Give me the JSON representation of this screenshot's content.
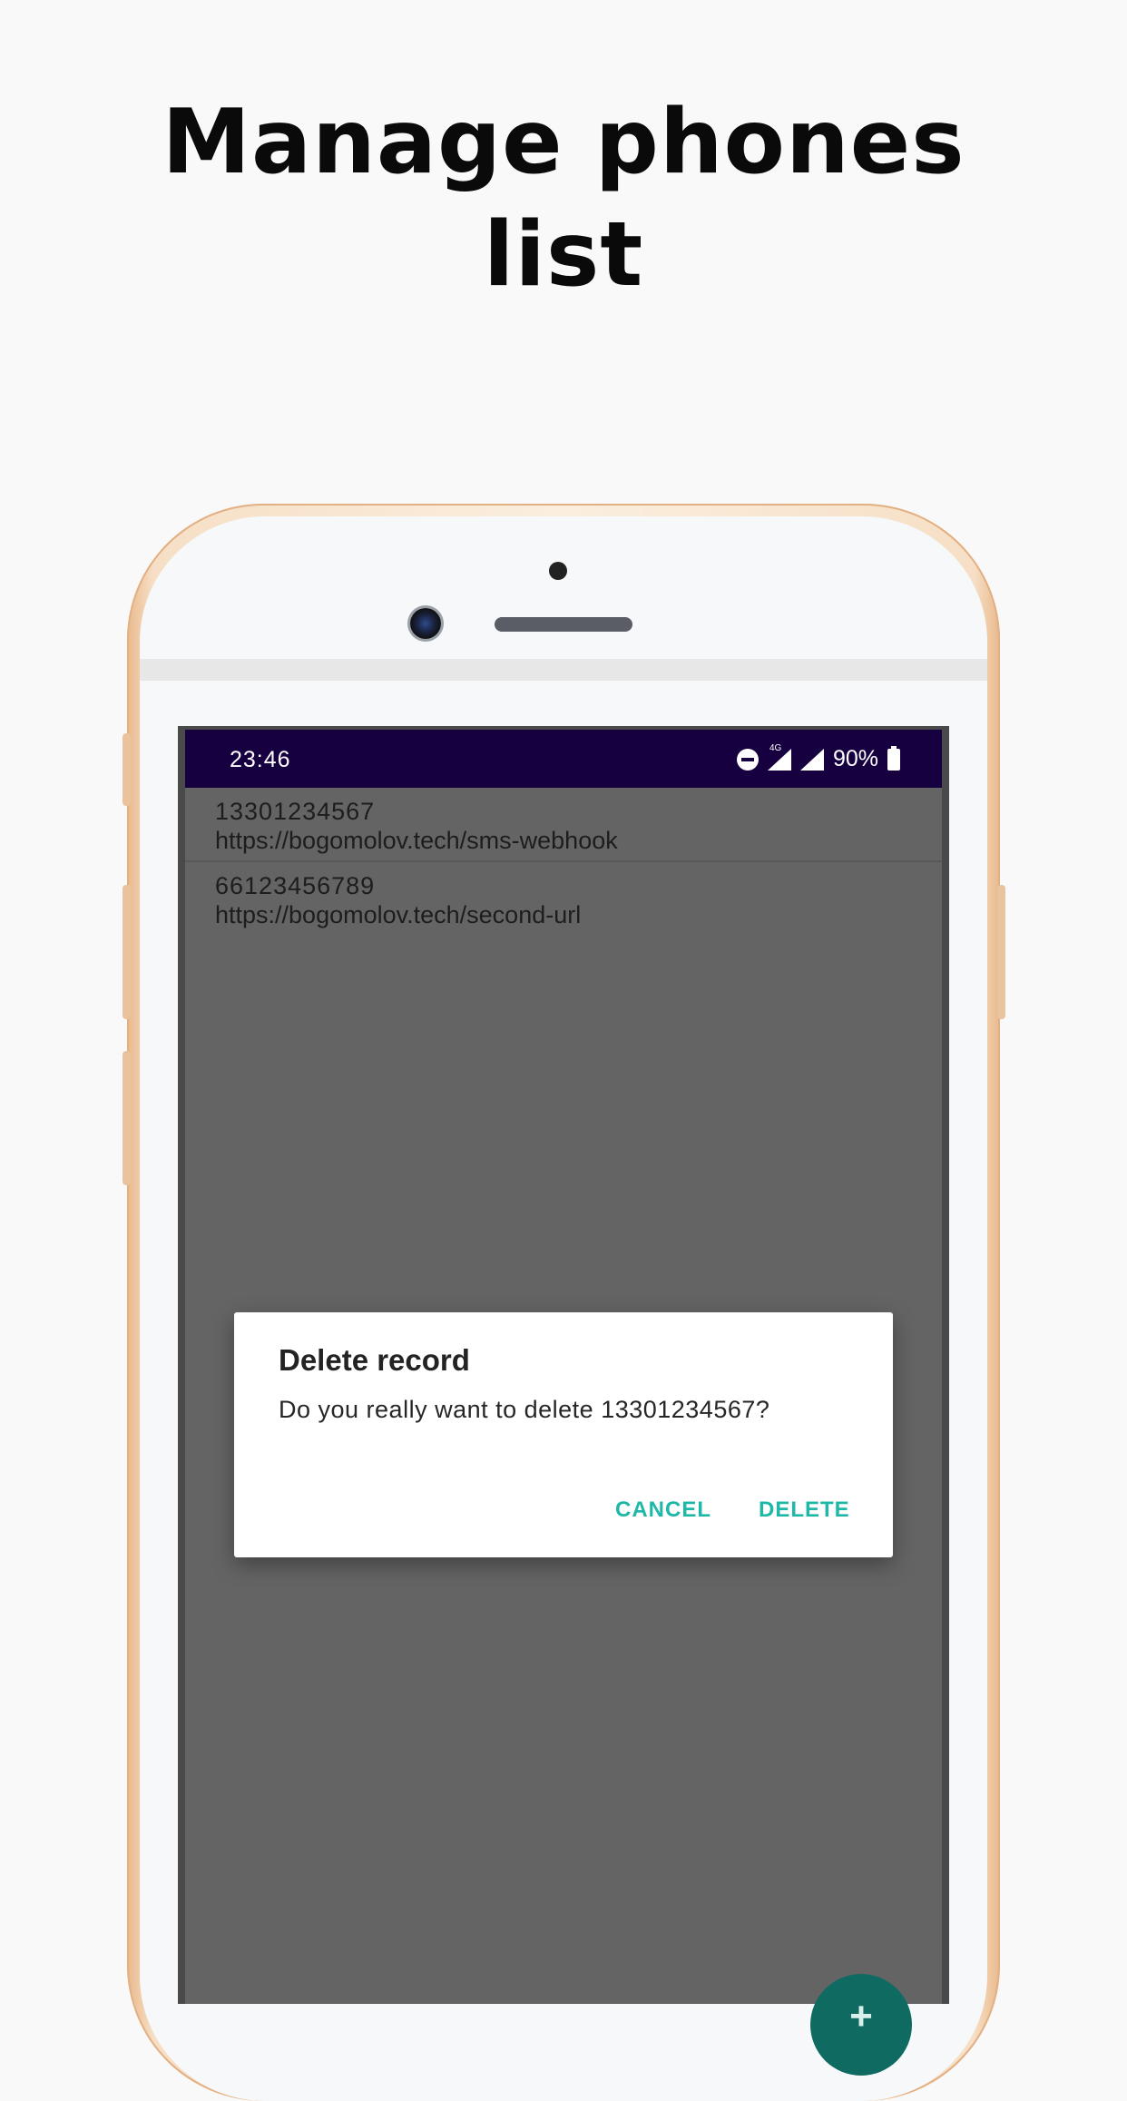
{
  "headline": {
    "line1": "Manage phones",
    "line2": "list"
  },
  "statusbar": {
    "time": "23:46",
    "network": "4G",
    "battery": "90%"
  },
  "records": [
    {
      "phone": "13301234567",
      "url": "https://bogomolov.tech/sms-webhook"
    },
    {
      "phone": "66123456789",
      "url": "https://bogomolov.tech/second-url"
    }
  ],
  "dialog": {
    "title": "Delete record",
    "message": "Do you really want to delete 13301234567?",
    "cancel_label": "CANCEL",
    "delete_label": "DELETE"
  },
  "fab": {
    "icon": "plus-icon",
    "label": "+"
  },
  "colors": {
    "statusbar": "#160040",
    "accent": "#1fb8a8",
    "fab": "#0f6b61",
    "scrim": "#646464"
  }
}
